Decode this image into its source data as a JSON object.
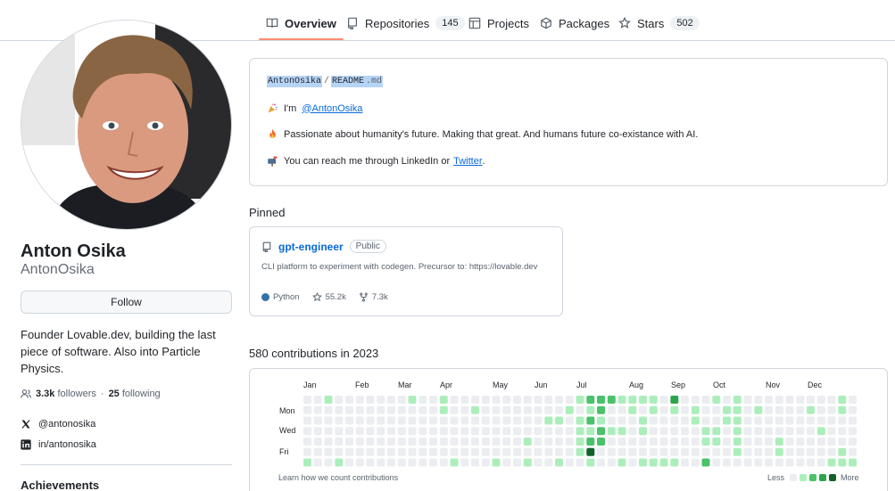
{
  "nav": {
    "tabs": [
      {
        "label": "Overview",
        "count": "",
        "icon": "book-icon"
      },
      {
        "label": "Repositories",
        "count": "145",
        "icon": "repo-icon"
      },
      {
        "label": "Projects",
        "count": "",
        "icon": "table-icon"
      },
      {
        "label": "Packages",
        "count": "",
        "icon": "package-icon"
      },
      {
        "label": "Stars",
        "count": "502",
        "icon": "star-icon"
      }
    ]
  },
  "profile": {
    "name": "Anton Osika",
    "login": "AntonOsika",
    "follow_label": "Follow",
    "bio": "Founder Lovable.dev, building the last piece of software. Also into Particle Physics.",
    "followers_count": "3.3k",
    "followers_label": "followers",
    "following_count": "25",
    "following_label": "following",
    "separator": "·",
    "twitter": "@antonosika",
    "linkedin": "in/antonosika",
    "achievements_title": "Achievements"
  },
  "readme": {
    "owner": "AntonOsika",
    "slash": "/",
    "file": "README",
    "ext": ".md",
    "line1_prefix": "I'm",
    "line1_link": "@AntonOsika",
    "line2": "Passionate about humanity's future. Making that great. And humans future co-existance with AI.",
    "line3_prefix": "You can reach me through LinkedIn or",
    "line3_link": "Twitter",
    "line3_suffix": "."
  },
  "pinned": {
    "title": "Pinned",
    "repo": {
      "name": "gpt-engineer",
      "visibility": "Public",
      "description": "CLI platform to experiment with codegen. Precursor to: https://lovable.dev",
      "language": "Python",
      "language_color": "#3572a5",
      "stars": "55.2k",
      "forks": "7.3k"
    }
  },
  "contributions": {
    "title": "580 contributions in 2023",
    "months": [
      "Jan",
      "Feb",
      "Mar",
      "Apr",
      "May",
      "Jun",
      "Jul",
      "Aug",
      "Sep",
      "Oct",
      "Nov",
      "Dec"
    ],
    "days": [
      "Mon",
      "Wed",
      "Fri"
    ],
    "learn_link": "Learn how we count contributions",
    "legend_less": "Less",
    "legend_more": "More",
    "level_colors": [
      "#ebedf0",
      "#aceebb",
      "#4ac26b",
      "#2da44e",
      "#116329"
    ],
    "weeks": [
      [
        0,
        0,
        0,
        0,
        0,
        0,
        1
      ],
      [
        0,
        0,
        0,
        0,
        0,
        0,
        0
      ],
      [
        1,
        0,
        0,
        0,
        0,
        0,
        0
      ],
      [
        0,
        0,
        0,
        0,
        0,
        0,
        1
      ],
      [
        0,
        0,
        0,
        0,
        0,
        0,
        0
      ],
      [
        0,
        0,
        0,
        0,
        0,
        0,
        0
      ],
      [
        0,
        0,
        0,
        0,
        0,
        0,
        0
      ],
      [
        0,
        0,
        0,
        0,
        0,
        0,
        0
      ],
      [
        0,
        0,
        0,
        0,
        0,
        0,
        0
      ],
      [
        0,
        0,
        0,
        0,
        0,
        0,
        0
      ],
      [
        1,
        0,
        0,
        0,
        0,
        0,
        0
      ],
      [
        0,
        0,
        0,
        0,
        0,
        0,
        0
      ],
      [
        0,
        0,
        0,
        0,
        0,
        0,
        0
      ],
      [
        1,
        1,
        0,
        0,
        0,
        0,
        0
      ],
      [
        0,
        0,
        0,
        0,
        0,
        0,
        1
      ],
      [
        0,
        0,
        0,
        0,
        0,
        0,
        0
      ],
      [
        0,
        1,
        0,
        0,
        0,
        0,
        0
      ],
      [
        0,
        0,
        0,
        0,
        0,
        0,
        0
      ],
      [
        0,
        0,
        0,
        0,
        0,
        0,
        1
      ],
      [
        0,
        0,
        0,
        0,
        0,
        0,
        0
      ],
      [
        0,
        0,
        0,
        0,
        0,
        0,
        0
      ],
      [
        0,
        0,
        0,
        0,
        1,
        0,
        1
      ],
      [
        0,
        0,
        0,
        0,
        0,
        0,
        0
      ],
      [
        0,
        0,
        1,
        0,
        0,
        0,
        0
      ],
      [
        0,
        0,
        1,
        0,
        0,
        0,
        1
      ],
      [
        0,
        1,
        0,
        0,
        0,
        0,
        0
      ],
      [
        1,
        0,
        1,
        1,
        1,
        1,
        0
      ],
      [
        2,
        1,
        2,
        1,
        2,
        4,
        1
      ],
      [
        2,
        2,
        1,
        2,
        2,
        0,
        0
      ],
      [
        2,
        0,
        0,
        1,
        0,
        0,
        0
      ],
      [
        1,
        0,
        0,
        1,
        0,
        0,
        1
      ],
      [
        1,
        1,
        0,
        0,
        0,
        0,
        0
      ],
      [
        1,
        0,
        1,
        1,
        0,
        0,
        1
      ],
      [
        1,
        1,
        0,
        0,
        0,
        0,
        1
      ],
      [
        0,
        0,
        0,
        0,
        0,
        0,
        1
      ],
      [
        3,
        1,
        0,
        0,
        0,
        0,
        1
      ],
      [
        0,
        0,
        0,
        0,
        0,
        0,
        0
      ],
      [
        0,
        1,
        1,
        0,
        0,
        0,
        0
      ],
      [
        0,
        0,
        0,
        1,
        1,
        0,
        2
      ],
      [
        1,
        0,
        0,
        1,
        1,
        0,
        0
      ],
      [
        0,
        1,
        1,
        0,
        0,
        0,
        0
      ],
      [
        1,
        1,
        1,
        1,
        1,
        1,
        0
      ],
      [
        0,
        0,
        0,
        0,
        0,
        0,
        0
      ],
      [
        0,
        1,
        0,
        0,
        0,
        0,
        0
      ],
      [
        0,
        0,
        0,
        0,
        0,
        0,
        0
      ],
      [
        0,
        0,
        0,
        0,
        1,
        1,
        0
      ],
      [
        0,
        0,
        0,
        0,
        0,
        0,
        0
      ],
      [
        0,
        0,
        0,
        0,
        0,
        0,
        0
      ],
      [
        0,
        1,
        0,
        0,
        0,
        0,
        0
      ],
      [
        0,
        0,
        0,
        1,
        0,
        0,
        0
      ],
      [
        0,
        0,
        0,
        0,
        0,
        0,
        1
      ],
      [
        1,
        1,
        0,
        0,
        0,
        1,
        1
      ],
      [
        0,
        0,
        0,
        0,
        0,
        0,
        1
      ],
      [
        0,
        0,
        0,
        0,
        0,
        0,
        0
      ],
      [
        0,
        0,
        0,
        0,
        0,
        0,
        0
      ],
      [
        0,
        0,
        0,
        1,
        0,
        0,
        0
      ],
      [
        0,
        0,
        0,
        0,
        0,
        0,
        0
      ],
      [
        0,
        0,
        0,
        0,
        0,
        0,
        0
      ],
      [
        0,
        0,
        0,
        0,
        0,
        0,
        0
      ],
      [
        0,
        0,
        0,
        0,
        0,
        0,
        0
      ],
      [
        0,
        0,
        0,
        0,
        0,
        0,
        0
      ],
      [
        0,
        0,
        0,
        0,
        0,
        0,
        0
      ],
      [
        0,
        0,
        0,
        0,
        0,
        0,
        0
      ]
    ]
  }
}
